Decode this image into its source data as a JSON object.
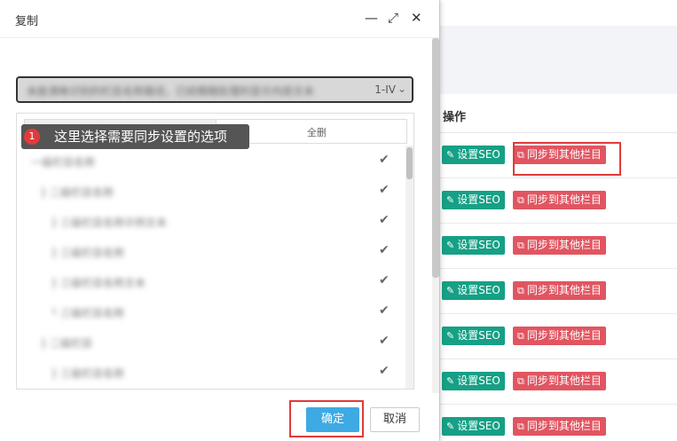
{
  "dialog": {
    "title": "复制",
    "controls": {
      "minimize": "—",
      "maximize": "⤢",
      "close": "✕"
    },
    "select": {
      "value_blurred": "未能清晰识别的栏目名称路径，已经模糊处理的显示内容文本",
      "tail": "1-IV",
      "chevron": "⌄"
    },
    "toolbar": {
      "delete_all_label": "全删"
    },
    "tree_items": [
      {
        "label": "一级栏目名称",
        "check": "✔"
      },
      {
        "label": "├ 二级栏目名称",
        "check": "✔"
      },
      {
        "label": "├ 三级栏目名称示例文本",
        "check": "✔"
      },
      {
        "label": "├ 三级栏目名称",
        "check": "✔"
      },
      {
        "label": "├ 三级栏目名称文本",
        "check": "✔"
      },
      {
        "label": "└ 三级栏目名称",
        "check": "✔"
      },
      {
        "label": "├ 二级栏目",
        "check": "✔"
      },
      {
        "label": "├ 三级栏目名称",
        "check": "✔"
      }
    ],
    "tooltip": {
      "number": "1",
      "text": "这里选择需要同步设置的选项"
    },
    "footer": {
      "ok_label": "确定",
      "cancel_label": "取消"
    }
  },
  "table": {
    "header": "操作",
    "rows": [
      {
        "seo_label": "设置SEO",
        "sync_label": "同步到其他栏目"
      },
      {
        "seo_label": "设置SEO",
        "sync_label": "同步到其他栏目"
      },
      {
        "seo_label": "设置SEO",
        "sync_label": "同步到其他栏目"
      },
      {
        "seo_label": "设置SEO",
        "sync_label": "同步到其他栏目"
      },
      {
        "seo_label": "设置SEO",
        "sync_label": "同步到其他栏目"
      },
      {
        "seo_label": "设置SEO",
        "sync_label": "同步到其他栏目"
      },
      {
        "seo_label": "设置SEO",
        "sync_label": "同步到其他栏目"
      }
    ]
  },
  "icons": {
    "edit": "edit-icon",
    "copy": "copy-icon",
    "check": "check-icon"
  },
  "colors": {
    "seo_button": "#16a085",
    "sync_button": "#e15561",
    "ok_button": "#3eaae3",
    "highlight": "#e13a3a",
    "tooltip_bg": "#555555"
  }
}
